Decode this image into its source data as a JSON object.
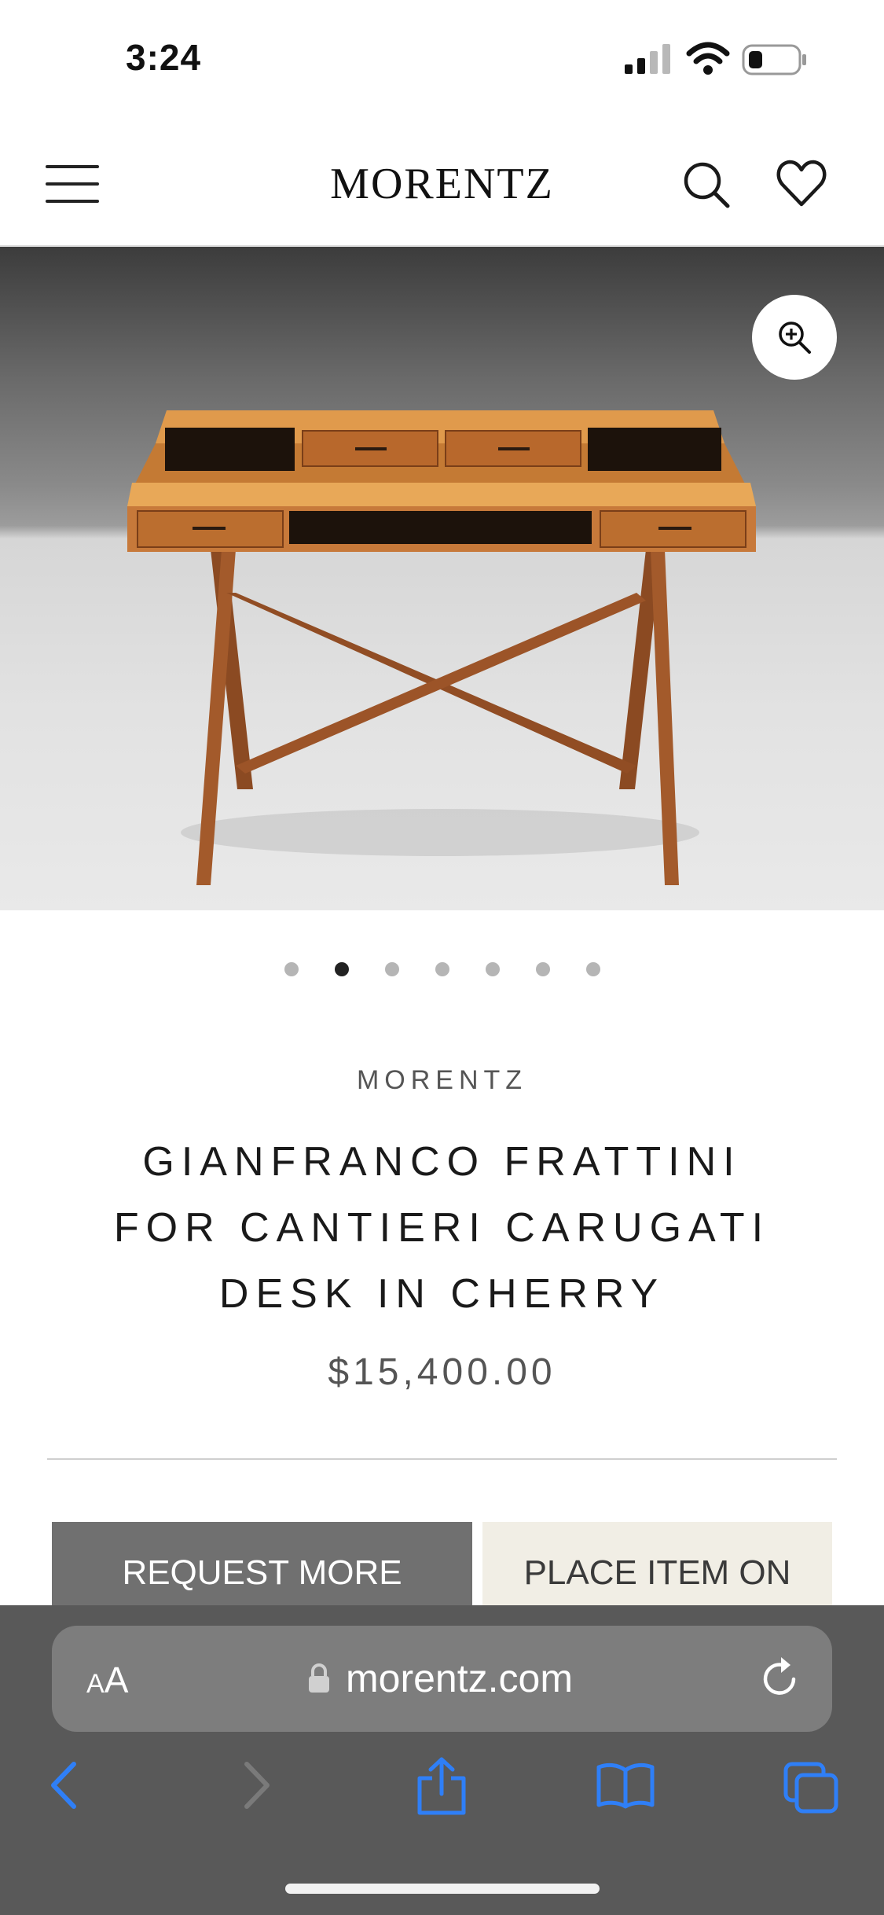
{
  "status_bar": {
    "time": "3:24",
    "icons": [
      "cellular-signal-icon",
      "wifi-icon",
      "battery-icon"
    ]
  },
  "header": {
    "logo": "MORENTZ",
    "icons": [
      "hamburger-menu-icon",
      "search-icon",
      "heart-icon"
    ]
  },
  "gallery": {
    "image_subject": "cherry wood writing desk with X-shaped legs",
    "zoom_icon": "zoom-in-icon",
    "slide_count": 7,
    "active_slide": 2
  },
  "product": {
    "vendor": "MORENTZ",
    "title_lines": [
      "GIANFRANCO FRATTINI",
      "FOR CANTIERI CARUGATI",
      "DESK IN CHERRY"
    ],
    "price": "$15,400.00",
    "buttons": {
      "request": "REQUEST MORE",
      "place": "PLACE ITEM ON"
    }
  },
  "browser": {
    "text_size_small": "A",
    "text_size_large": "A",
    "url": "morentz.com",
    "icons": [
      "lock-icon",
      "reload-icon",
      "back-icon",
      "forward-icon",
      "share-icon",
      "bookmarks-icon",
      "tabs-icon"
    ]
  },
  "colors": {
    "accent_button": "#707070",
    "secondary_button": "#f1eee5",
    "browser_bar": "#595959",
    "browser_icon_blue": "#2f7ff7"
  }
}
